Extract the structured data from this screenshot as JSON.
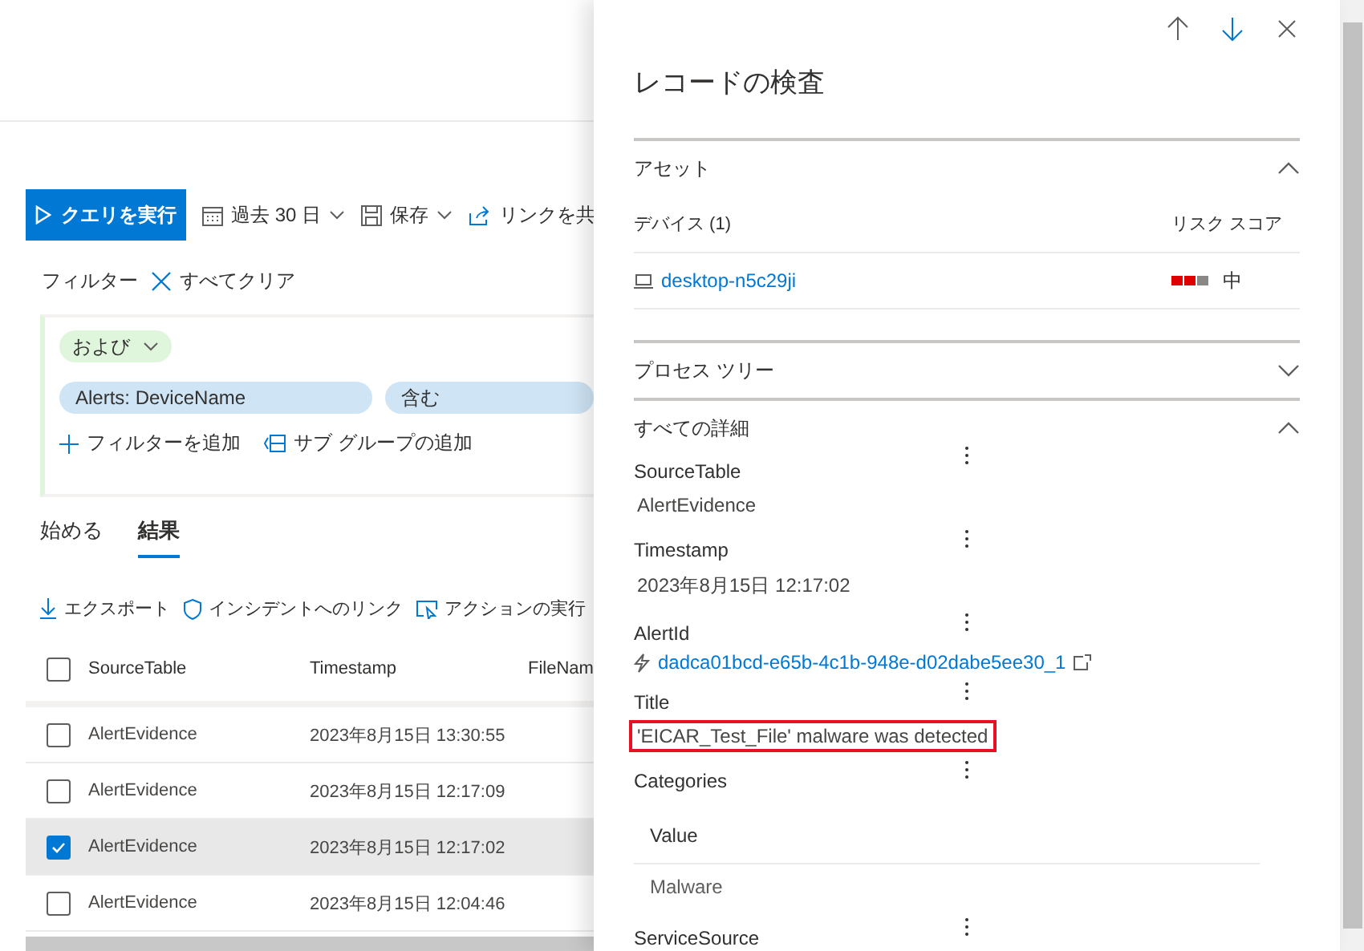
{
  "toolbar": {
    "run_button": "クエリを実行",
    "time_range": "過去 30 日",
    "save": "保存",
    "share": "リンクを共"
  },
  "filter": {
    "label": "フィルター",
    "clear": "すべてクリア",
    "operator": "および",
    "field": "Alerts: DeviceName",
    "condition": "含む",
    "add_filter": "フィルターを追加",
    "add_subgroup": "サブ グループの追加"
  },
  "tabs": [
    {
      "label": "始める",
      "selected": false
    },
    {
      "label": "結果",
      "selected": true
    }
  ],
  "actions": [
    "エクスポート",
    "インシデントへのリンク",
    "アクションの実行"
  ],
  "table": {
    "all_selected": false,
    "columns": [
      "SourceTable",
      "Timestamp",
      "FileNam"
    ],
    "rows": [
      {
        "cells": [
          "AlertEvidence",
          "2023年8月15日 13:30:55"
        ],
        "selected": false
      },
      {
        "cells": [
          "AlertEvidence",
          "2023年8月15日 12:17:09"
        ],
        "selected": false
      },
      {
        "cells": [
          "AlertEvidence",
          "2023年8月15日 12:17:02"
        ],
        "selected": true
      },
      {
        "cells": [
          "AlertEvidence",
          "2023年8月15日 12:04:46"
        ],
        "selected": false
      }
    ]
  },
  "panel": {
    "title": "レコードの検査",
    "assets": {
      "title": "アセット",
      "expanded": true,
      "device_header": "デバイス (1)",
      "risk_header": "リスク スコア",
      "device": "desktop-n5c29ji",
      "level": 0.67,
      "risk_label": "中"
    },
    "process_tree": {
      "title": "プロセス ツリー",
      "expanded": false
    },
    "details": {
      "title": "すべての詳細",
      "expanded": true,
      "fields": [
        {
          "label": "SourceTable",
          "kind": "text",
          "value": "AlertEvidence"
        },
        {
          "label": "Timestamp",
          "kind": "text",
          "value": "2023年8月15日 12:17:02"
        },
        {
          "label": "AlertId",
          "kind": "link",
          "value": "dadca01bcd-e65b-4c1b-948e-d02dabe5ee30_1"
        },
        {
          "label": "Title",
          "kind": "text",
          "value": "'EICAR_Test_File' malware was detected",
          "highlighted": true
        },
        {
          "label": "Categories",
          "kind": "table",
          "header": "Value",
          "values": [
            "Malware"
          ]
        },
        {
          "label": "ServiceSource",
          "kind": "none"
        }
      ]
    }
  }
}
